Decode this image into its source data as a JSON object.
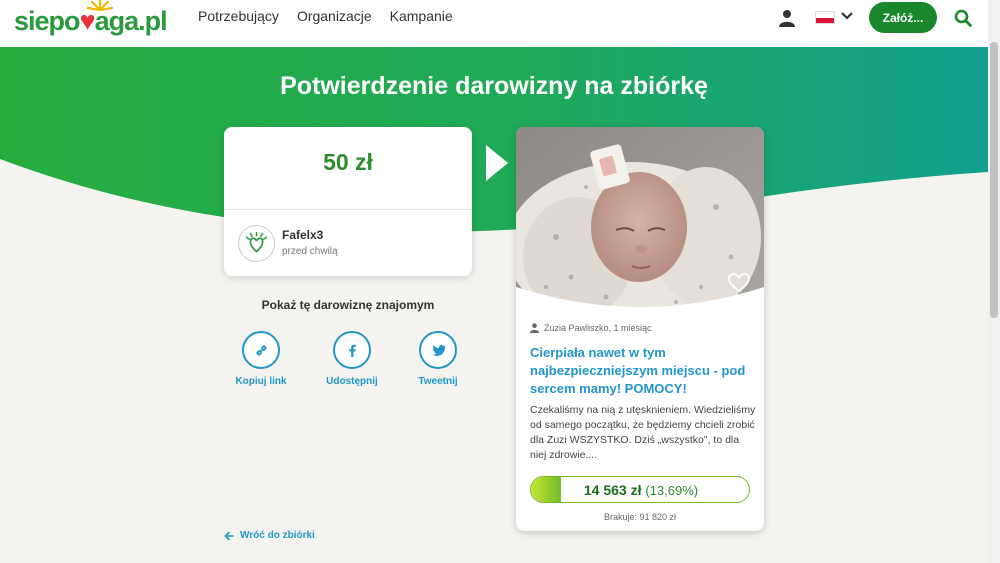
{
  "header": {
    "logo": "siepomaga.pl",
    "nav": [
      "Potrzebujący",
      "Organizacje",
      "Kampanie"
    ],
    "cta_label": "Załóż...",
    "icons": [
      "user-icon",
      "flag-pl-icon",
      "chevron-down-icon",
      "search-icon"
    ]
  },
  "colors": {
    "brand_green": "#19882d",
    "link_blue": "#2196c9",
    "amount_green": "#2e8b2e"
  },
  "page": {
    "title": "Potwierdzenie darowizny na zbiórkę"
  },
  "donation": {
    "amount": "50 zł",
    "donor": "Fafelx3",
    "time": "przed chwilą"
  },
  "share": {
    "title": "Pokaż tę darowiznę znajomym",
    "buttons": [
      {
        "label": "Kopiuj link",
        "icon": "link-icon"
      },
      {
        "label": "Udostępnij",
        "icon": "facebook-icon"
      },
      {
        "label": "Tweetnij",
        "icon": "twitter-icon"
      }
    ]
  },
  "back_link": "Wróć do zbiórki",
  "campaign": {
    "author": "Zuzia Pawliszko, 1 miesiąc",
    "title": "Cierpiała nawet w tym najbezpieczniejszym miejscu - pod sercem mamy! POMOCY!",
    "description": "Czekaliśmy na nią z utęsknieniem. Wiedzieliśmy od samego początku, że będziemy chcieli zrobić dla Zuzi WSZYSTKO. Dziś „wszystko\", to dla niej zdrowie....",
    "raised": "14 563 zł",
    "percent_label": "(13,69%)",
    "progress": 0.1369,
    "missing": "Brakuje: 91 820 zł"
  }
}
